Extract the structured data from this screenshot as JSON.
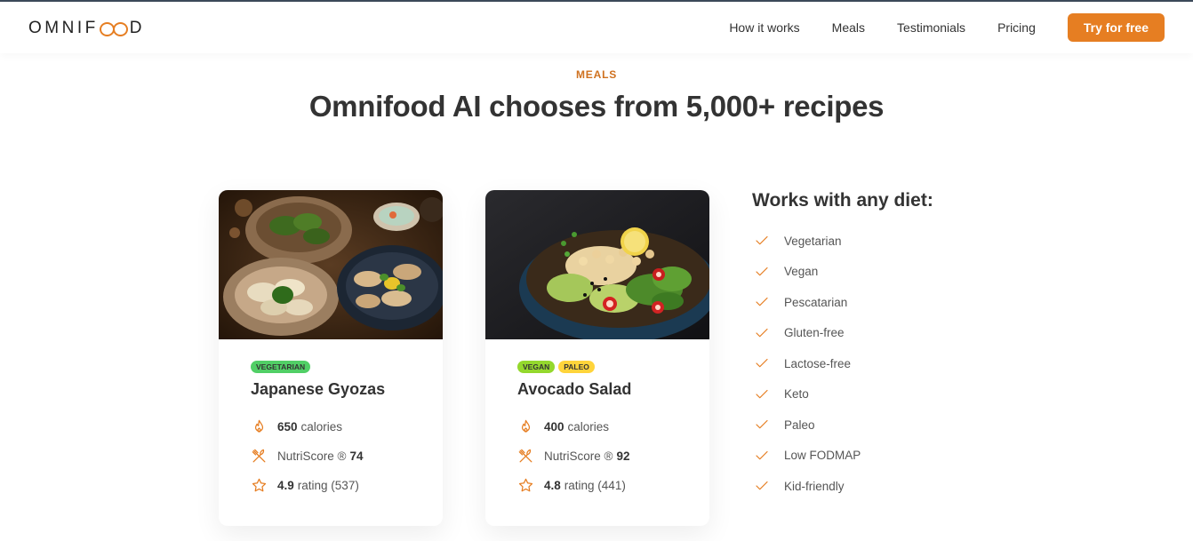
{
  "header": {
    "logo": {
      "prefix": "OMNIF",
      "suffix": "D"
    },
    "nav": [
      "How it works",
      "Meals",
      "Testimonials",
      "Pricing"
    ],
    "cta": "Try for free"
  },
  "section": {
    "subheading": "MEALS",
    "heading": "Omnifood AI chooses from 5,000+ recipes"
  },
  "meals": [
    {
      "tags": [
        "VEGETARIAN"
      ],
      "title": "Japanese Gyozas",
      "calories_value": "650",
      "calories_label": "calories",
      "nutri_label": "NutriScore ®",
      "nutri_value": "74",
      "rating_value": "4.9",
      "rating_label": "rating (537)"
    },
    {
      "tags": [
        "VEGAN",
        "PALEO"
      ],
      "title": "Avocado Salad",
      "calories_value": "400",
      "calories_label": "calories",
      "nutri_label": "NutriScore ®",
      "nutri_value": "92",
      "rating_value": "4.8",
      "rating_label": "rating (441)"
    }
  ],
  "diets": {
    "title": "Works with any diet:",
    "items": [
      "Vegetarian",
      "Vegan",
      "Pescatarian",
      "Gluten-free",
      "Lactose-free",
      "Keto",
      "Paleo",
      "Low FODMAP",
      "Kid-friendly"
    ]
  },
  "colors": {
    "accent": "#e67e22",
    "text": "#333333",
    "vegetarian": "#51cf66",
    "vegan": "#94d82d",
    "paleo": "#ffd43b"
  },
  "icons": {
    "calories": "flame-icon",
    "nutri": "fork-knife-icon",
    "rating": "star-icon",
    "check": "check-icon"
  }
}
